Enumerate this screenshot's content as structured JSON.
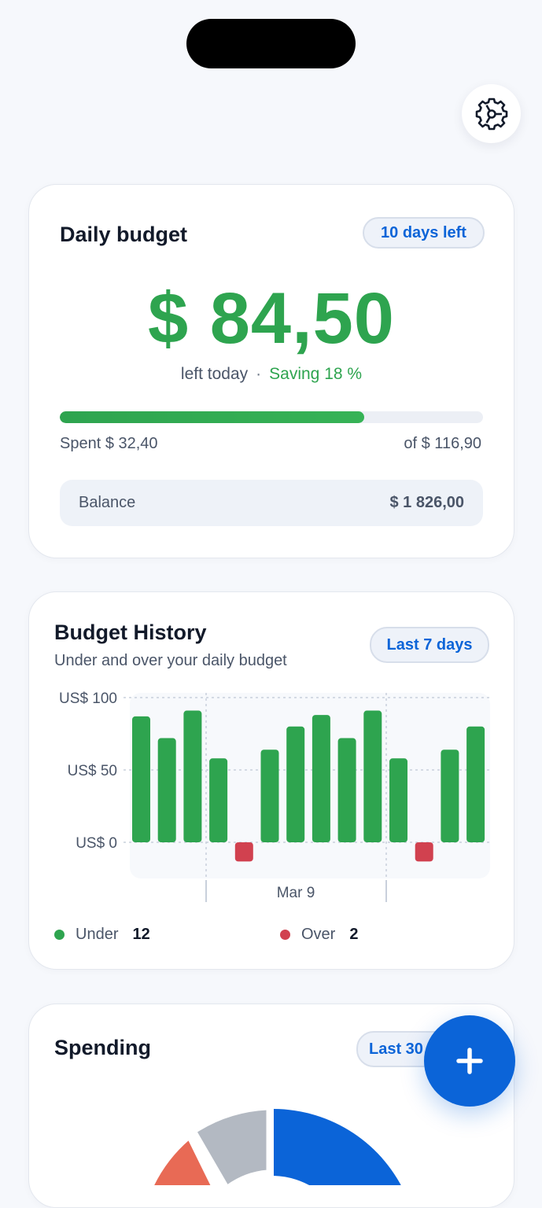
{
  "colors": {
    "accent": "#0b64d8",
    "positive": "#2ea44f",
    "negative": "#d1414f"
  },
  "daily_budget": {
    "title": "Daily budget",
    "days_left": "10 days left",
    "amount": "$ 84,50",
    "left_today": "left today",
    "separator": "·",
    "saving": "Saving 18 %",
    "progress_fraction": 0.72,
    "spent": "Spent $ 32,40",
    "of_total": "of $ 116,90",
    "balance_label": "Balance",
    "balance_value": "$ 1 826,00"
  },
  "history": {
    "title": "Budget History",
    "subtitle": "Under and over your daily budget",
    "range": "Last 7 days",
    "legend": {
      "under_label": "Under",
      "under_count": "12",
      "over_label": "Over",
      "over_count": "2"
    }
  },
  "chart_data": {
    "type": "bar",
    "ylim": [
      0,
      100
    ],
    "yticks": [
      {
        "value": 100,
        "label": "US$ 100"
      },
      {
        "value": 50,
        "label": "US$ 50"
      },
      {
        "value": 0,
        "label": "US$ 0"
      }
    ],
    "x_tick_label": "Mar 9",
    "series": [
      {
        "values": [
          87,
          72,
          91,
          58,
          -10,
          64,
          80,
          88,
          72,
          91,
          58,
          -10,
          64,
          80
        ]
      }
    ],
    "grid": true
  },
  "spending": {
    "title": "Spending",
    "range": "Last 30",
    "donut_colors": [
      "#0b64d8",
      "#b3b9c2",
      "#e86a55"
    ]
  },
  "icons": {
    "settings": "gear-icon",
    "add": "plus-icon"
  }
}
